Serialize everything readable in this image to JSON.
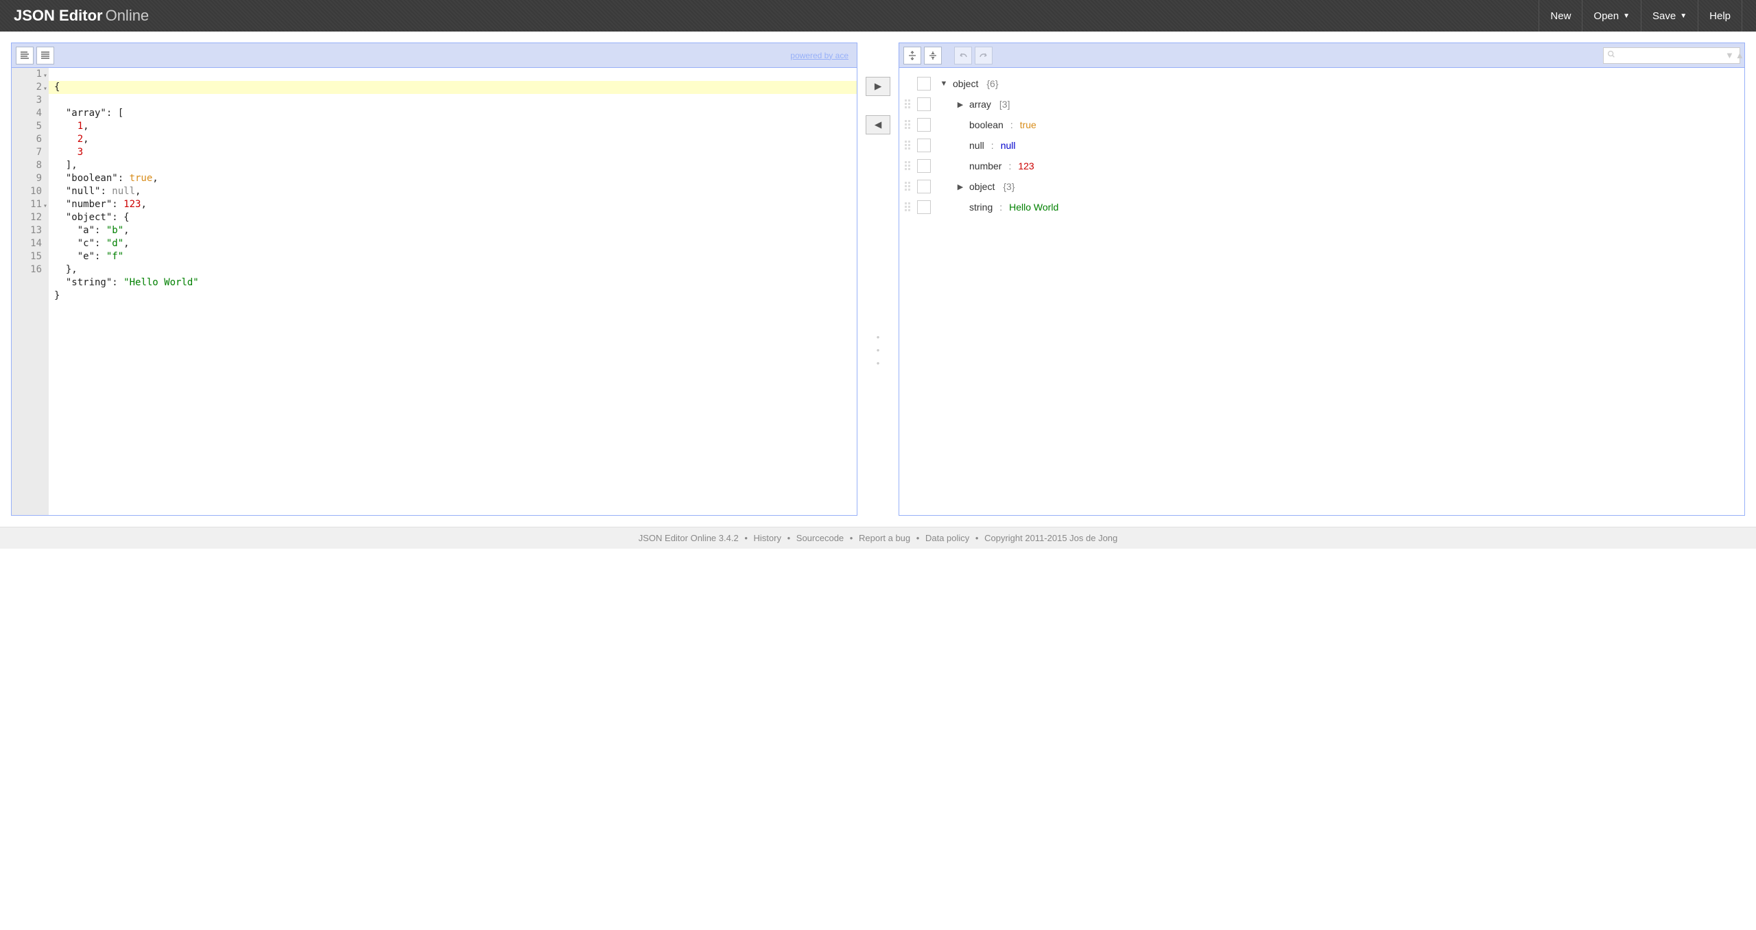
{
  "header": {
    "logo_bold": "JSON Editor",
    "logo_light": "Online",
    "menu": {
      "new": "New",
      "open": "Open",
      "save": "Save",
      "help": "Help"
    }
  },
  "left_panel": {
    "powered_by": "powered by ace",
    "code_lines": [
      "{",
      "  \"array\": [",
      "    1,",
      "    2,",
      "    3",
      "  ],",
      "  \"boolean\": true,",
      "  \"null\": null,",
      "  \"number\": 123,",
      "  \"object\": {",
      "    \"a\": \"b\",",
      "    \"c\": \"d\",",
      "    \"e\": \"f\"",
      "  },",
      "  \"string\": \"Hello World\"",
      "}"
    ],
    "line_numbers": [
      "1",
      "2",
      "3",
      "4",
      "5",
      "6",
      "7",
      "8",
      "9",
      "10",
      "11",
      "12",
      "13",
      "14",
      "15",
      "16"
    ]
  },
  "right_panel": {
    "search_placeholder": "",
    "tree": [
      {
        "expand": "down",
        "key": "object",
        "count": "{6}",
        "indent": 0
      },
      {
        "expand": "right",
        "key": "array",
        "count": "[3]",
        "indent": 1
      },
      {
        "key": "boolean",
        "sep": ":",
        "val": "true",
        "valtype": "bool",
        "indent": 1
      },
      {
        "key": "null",
        "sep": ":",
        "val": "null",
        "valtype": "null",
        "indent": 1
      },
      {
        "key": "number",
        "sep": ":",
        "val": "123",
        "valtype": "num",
        "indent": 1
      },
      {
        "expand": "right",
        "key": "object",
        "count": "{3}",
        "indent": 1
      },
      {
        "key": "string",
        "sep": ":",
        "val": "Hello World",
        "valtype": "str",
        "indent": 1
      }
    ]
  },
  "footer": {
    "product": "JSON Editor Online 3.4.2",
    "links": [
      "History",
      "Sourcecode",
      "Report a bug",
      "Data policy"
    ],
    "copyright": "Copyright 2011-2015 Jos de Jong"
  }
}
